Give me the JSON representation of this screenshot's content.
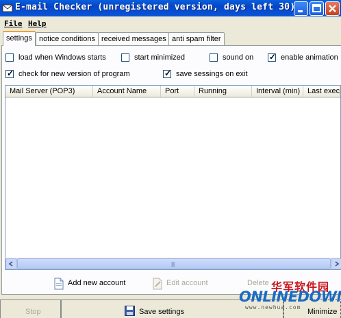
{
  "window": {
    "title": "E-mail Checker (unregistered version, days left 30)",
    "controls": {
      "minimize": "minimize-icon",
      "maximize": "maximize-icon",
      "close": "close-icon"
    }
  },
  "menu": {
    "items": [
      "File",
      "Help"
    ]
  },
  "tabs": [
    "settings",
    "notice conditions",
    "received messages",
    "anti spam filter"
  ],
  "settings": {
    "options": [
      {
        "label": "load when Windows starts",
        "checked": false
      },
      {
        "label": "start minimized",
        "checked": false
      },
      {
        "label": "sound on",
        "checked": false
      },
      {
        "label": "enable animation",
        "checked": true
      },
      {
        "label": "check for new version of program",
        "checked": true
      },
      {
        "label": "save sessings on exit",
        "checked": true
      }
    ]
  },
  "table": {
    "columns": [
      "Mail Server (POP3)",
      "Account Name",
      "Port",
      "Running",
      "Interval (min)",
      "Last exec"
    ],
    "rows": []
  },
  "actions": {
    "add": "Add new account",
    "edit": "Edit account",
    "delete": "Delete"
  },
  "bottom": {
    "stop": "Stop",
    "save": "Save settings",
    "minimize": "Minimize"
  },
  "watermark": {
    "cn": "华军软件园",
    "logo": "ONLINEDOWN",
    "url": "www.newhua.com"
  },
  "colors": {
    "titlebar": "#0546c8",
    "panel": "#ece9d8",
    "active_tab_accent": "#f0a030"
  }
}
